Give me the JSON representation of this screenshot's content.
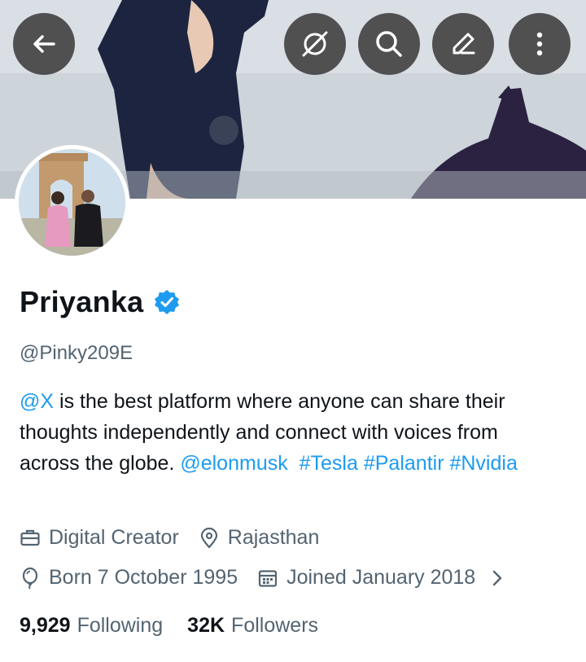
{
  "profile": {
    "name": "Priyanka",
    "handle": "@Pinky209E",
    "bio": {
      "mention_x": "@X",
      "text1": " is the best platform where anyone can share their thoughts independently and connect with voices from across the globe. ",
      "mention_elon": "@elonmusk",
      "tag_tesla": "#Tesla",
      "tag_palantir": "#Palantir",
      "tag_nvidia": "#Nvidia"
    },
    "category": "Digital Creator",
    "location": "Rajasthan",
    "born": "Born 7 October 1995",
    "joined": "Joined January 2018",
    "following_count": "9,929",
    "following_label": "Following",
    "followers_count": "32K",
    "followers_label": "Followers"
  },
  "colors": {
    "accent": "#1d9bf0",
    "text_primary": "#0f1419",
    "text_secondary": "#536471",
    "button_bg": "#3c3c3c"
  },
  "icons": {
    "back": "arrow-left-icon",
    "grok": "grok-icon",
    "search": "search-icon",
    "edit": "pencil-icon",
    "more": "more-vertical-icon",
    "verified": "verified-badge-icon",
    "category": "briefcase-icon",
    "location": "location-pin-icon",
    "born": "balloon-icon",
    "joined": "calendar-icon",
    "expand": "chevron-right-icon"
  }
}
